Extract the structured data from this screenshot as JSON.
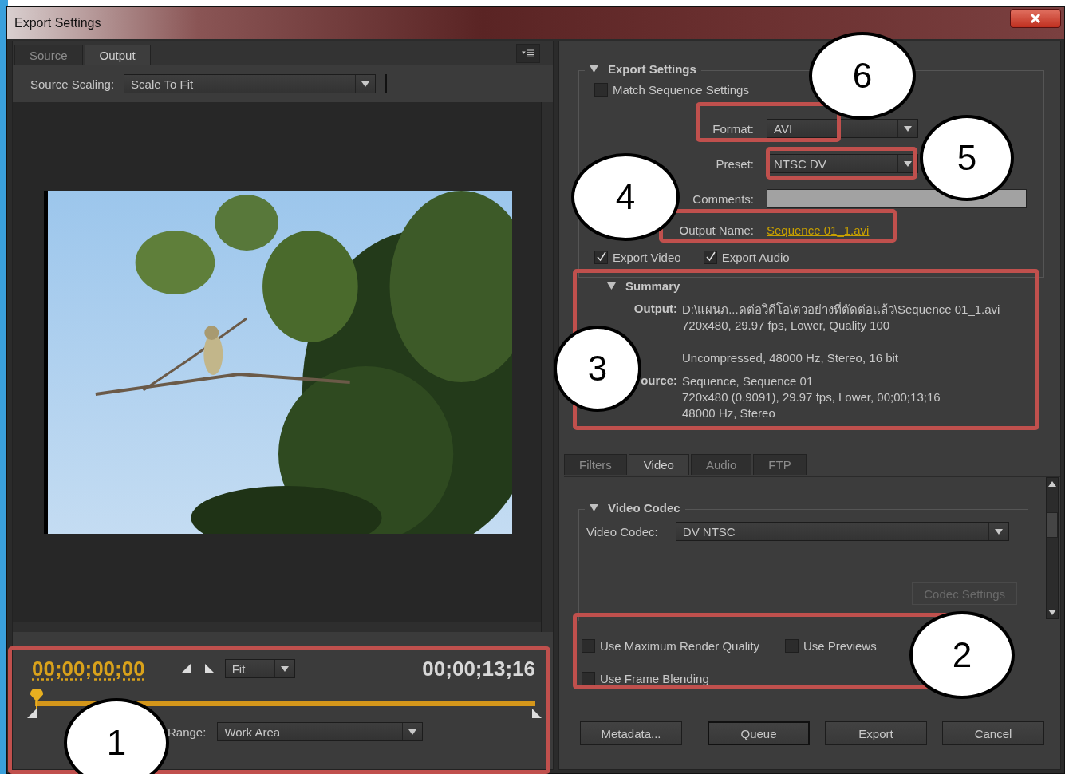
{
  "window": {
    "title": "Export Settings"
  },
  "left": {
    "tabs": [
      {
        "label": "Source",
        "selected": false
      },
      {
        "label": "Output",
        "selected": true
      }
    ],
    "source_scaling": {
      "label": "Source Scaling:",
      "value": "Scale To Fit"
    },
    "timeline": {
      "current_time": "00;00;00;00",
      "zoom": "Fit",
      "duration": "00;00;13;16",
      "range_label": "Range:",
      "range": "Work Area"
    }
  },
  "export_settings": {
    "title": "Export Settings",
    "expanded": true,
    "match_sequence": {
      "label": "Match Sequence Settings",
      "checked": false
    },
    "format": {
      "label": "Format:",
      "value": "AVI"
    },
    "preset": {
      "label": "Preset:",
      "value": "NTSC DV"
    },
    "comments": {
      "label": "Comments:"
    },
    "output_name": {
      "label": "Output Name:",
      "value": "Sequence 01_1.avi"
    },
    "export_video": {
      "label": "Export Video",
      "checked": true
    },
    "export_audio": {
      "label": "Export Audio",
      "checked": true
    }
  },
  "summary": {
    "title": "Summary",
    "expanded": true,
    "rows": [
      {
        "label": "Output:",
        "lines": [
          "D:\\แผนภ...ดต่อวิดีโอ\\ตวอย่างที่ตัดต่อแล้ว\\Sequence 01_1.avi",
          "720x480, 29.97 fps, Lower, Quality 100"
        ]
      },
      {
        "lines": [
          "Uncompressed, 48000 Hz, Stereo, 16 bit"
        ]
      },
      {
        "label": "ource:",
        "lines": [
          "Sequence, Sequence 01",
          "720x480 (0.9091), 29.97 fps, Lower, 00;00;13;16",
          "48000 Hz, Stereo"
        ]
      }
    ]
  },
  "tabs": [
    {
      "label": "Filters",
      "selected": false
    },
    {
      "label": "Video",
      "selected": true
    },
    {
      "label": "Audio",
      "selected": false
    },
    {
      "label": "FTP",
      "selected": false
    }
  ],
  "video_codec": {
    "title": "Video Codec",
    "expanded": true,
    "label": "Video Codec:",
    "value": "DV NTSC",
    "settings_button": {
      "label": "Codec Settings",
      "disabled": true
    }
  },
  "options": [
    {
      "label": "Use Maximum Render Quality",
      "checked": false
    },
    {
      "label": "Use Previews",
      "checked": false
    },
    {
      "label": "Use Frame Blending",
      "checked": false
    }
  ],
  "buttons": [
    {
      "label": "Metadata...",
      "default": false
    },
    {
      "label": "Queue",
      "default": true
    },
    {
      "label": "Export",
      "default": false
    },
    {
      "label": "Cancel",
      "default": false
    }
  ],
  "annotations": [
    {
      "number": "1"
    },
    {
      "number": "2"
    },
    {
      "number": "3"
    },
    {
      "number": "4"
    },
    {
      "number": "5"
    },
    {
      "number": "6"
    }
  ]
}
